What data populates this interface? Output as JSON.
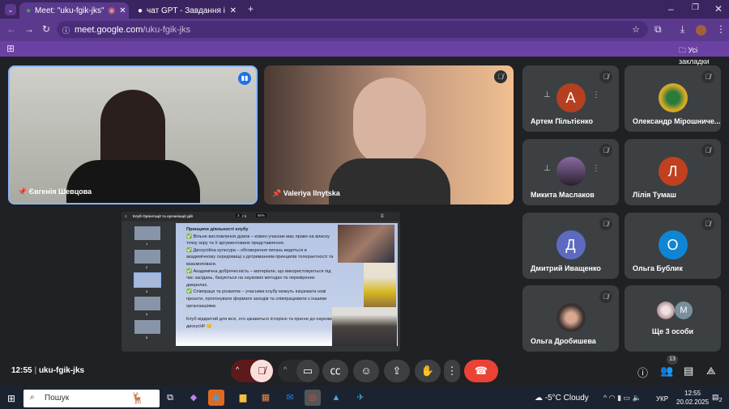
{
  "browser": {
    "tabs": [
      {
        "title": "Meet: \"uku-fgik-jks\"",
        "active": true
      },
      {
        "title": "чат GPT - Завдання і допомога",
        "active": false
      }
    ],
    "url_host": "meet.google.com",
    "url_path": "/uku-fgik-jks",
    "bookmarks_label": "Усі закладки"
  },
  "meet": {
    "main_tiles": [
      {
        "name": "Євгенія Шевцова",
        "speaking": true
      },
      {
        "name": "Valeriya Ilnytska",
        "speaking": false
      }
    ],
    "participants": [
      {
        "name": "Артем Пільтієнко",
        "initial": "А",
        "color": "#b5401f"
      },
      {
        "name": "Олександр Мірошниче...",
        "initial": "",
        "color": "#d4a828"
      },
      {
        "name": "Микита Маслаков",
        "initial": "",
        "color": "#6b5a80"
      },
      {
        "name": "Лілія Тумаш",
        "initial": "Л",
        "color": "#c1401f"
      },
      {
        "name": "Дмитрий Иващенко",
        "initial": "Д",
        "color": "#5c6bc0"
      },
      {
        "name": "Ольга Бублик",
        "initial": "О",
        "color": "#0f86d4"
      },
      {
        "name": "Ольга Дробишева",
        "initial": "",
        "color": "#5a4a40"
      }
    ],
    "more": {
      "label": "Ще 3 особи",
      "initial": "M"
    },
    "presentation": {
      "doc_title": "Клуб Орієнтації та організації дій",
      "page": "3",
      "pages": "/ 5",
      "zoom": "66%",
      "thumb_numbers": [
        "1",
        "2",
        "3",
        "4",
        "5"
      ],
      "heading": "Принципи діяльності клубу",
      "bullets": [
        "✅ Вільне висловлення думок – кожен учасник має право на власну точку зору та її аргументоване представлення.",
        "✅ Дискусійна культура – обговорення питань ведеться в академічному середовищі з дотриманням принципів толерантності та взаємоповаги.",
        "✅ Академічна доброчесність – матеріали, що використовуються під час засідань, базуються на наукових методах та перевірених джерелах.",
        "✅ Співпраця та розвиток – учасники клубу можуть ініціювати нові проєкти, пропонувати формати заходів та співпрацювати з іншими організаціями."
      ],
      "closing": "Клуб відкритий для всіх, хто цікавиться історією та прагне до наукових дискусій! 😊"
    },
    "time": "12:55",
    "code": "uku-fgik-jks",
    "participant_count": "13"
  },
  "taskbar": {
    "search": "Пошук",
    "weather": "-5°C  Cloudy",
    "lang": "УКР",
    "time": "12:55",
    "date": "20.02.2025",
    "notif": "2"
  },
  "colors": {
    "accent": "#8ab4f8",
    "end_call": "#ea4335",
    "browser": "#5b3a8e"
  }
}
